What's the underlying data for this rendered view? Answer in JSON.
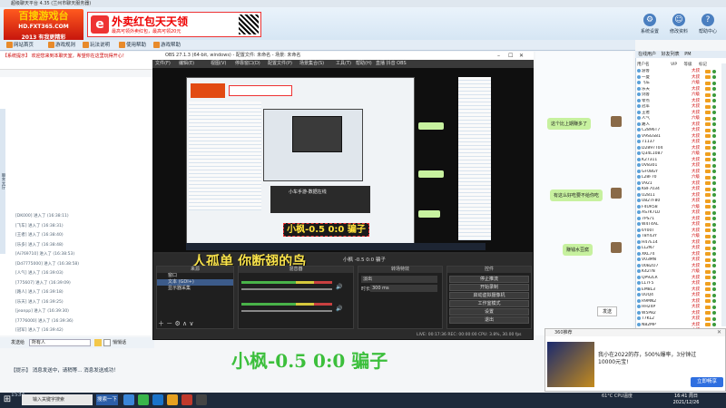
{
  "client": {
    "window_title": "超级聊天平台 4.35 (兰州市聊天服务器)",
    "logo_main": "百搜游戏台",
    "logo_url": "HD.FXT365.COM",
    "logo_sub": "2013 有我更精彩",
    "ad_text": "外卖红包天天领",
    "ad_sub": "最高可领外卖红包，最高可领20元",
    "header_buttons": [
      "系统设置",
      "修改资料",
      "帮助中心"
    ],
    "tabs": [
      "网站首页",
      "游戏规则",
      "玩法说明",
      "使用帮助",
      "游戏帮助"
    ],
    "announcement": "【系统提示】 欢迎您来到本聊天室，希望你在这里玩得开心！",
    "left_rail_label": "聊天大厅",
    "messages": [
      "[DK000] 进入了 (16:38:11)",
      "[飞车] 进入了 (16:38:31)",
      "[王者] 进入了 (16:38:40)",
      "[乐多] 进入了 (16:38:48)",
      "[Ai769710] 进入了 (16:38:53)",
      "[Dd7775000] 进入了 (16:38:58)",
      "[人气] 进入了 (16:39:03)",
      "[775607] 进入了 (16:39:09)",
      "[路人] 进入了 (16:39:18)",
      "[乐天] 进入了 (16:39:25)",
      "[jeanpp] 进入了 (16:39:30)",
      "[7776000] 进入了 (16:39:36)",
      "[冠军] 进入了 (16:39:42)"
    ],
    "input_label": "发送给",
    "input_value": "所有人",
    "checkbox_label": "悄悄话",
    "bottom_status": "【提示】 消息发送中，请稍等... 消息发送成功！",
    "send_label": "发送"
  },
  "userlist": {
    "tabs": [
      "在线用户",
      "好友列表",
      "PM"
    ],
    "headers": [
      "用户名",
      "VIP",
      "等级",
      "标记"
    ],
    "users": [
      {
        "name": "游客",
        "level": "大叔"
      },
      {
        "name": "一夏",
        "level": "大叔"
      },
      {
        "name": "飞车",
        "level": "六级"
      },
      {
        "name": "乐天",
        "level": "大叔"
      },
      {
        "name": "剑客",
        "level": "六级"
      },
      {
        "name": "零点",
        "level": "大叔"
      },
      {
        "name": "冠军",
        "level": "大叔"
      },
      {
        "name": "王者",
        "level": "大叔"
      },
      {
        "name": "人气",
        "level": "六级"
      },
      {
        "name": "路人",
        "level": "大叔"
      },
      {
        "name": "C2896T7",
        "level": "大叔"
      },
      {
        "name": "V9SGS81",
        "level": "大叔"
      },
      {
        "name": "71137",
        "level": "大叔"
      },
      {
        "name": "D2897T04",
        "level": "大叔"
      },
      {
        "name": "Q34L1087",
        "level": "六级"
      },
      {
        "name": "K27311",
        "level": "大叔"
      },
      {
        "name": "0V8301",
        "level": "大叔"
      },
      {
        "name": "GF08GY",
        "level": "大叔"
      },
      {
        "name": "L28F70",
        "level": "六级"
      },
      {
        "name": "V921",
        "level": "大叔"
      },
      {
        "name": "K8F7034",
        "level": "大叔"
      },
      {
        "name": "U2811",
        "level": "大叔"
      },
      {
        "name": "U827F80",
        "level": "大叔"
      },
      {
        "name": "F4UR58",
        "level": "六级"
      },
      {
        "name": "AS7K7LU",
        "level": "大叔"
      },
      {
        "name": "7PS71",
        "level": "大叔"
      },
      {
        "name": "W4T4AL",
        "level": "大叔"
      },
      {
        "name": "6Y00T",
        "level": "大叔"
      },
      {
        "name": "T8Y43Y",
        "level": "六级"
      },
      {
        "name": "H47E14",
        "level": "大叔"
      },
      {
        "name": "LL2N7",
        "level": "大叔"
      },
      {
        "name": "XKL74",
        "level": "大叔"
      },
      {
        "name": "V03MN",
        "level": "大叔"
      },
      {
        "name": "00BZO7",
        "level": "大叔"
      },
      {
        "name": "K42TN",
        "level": "六级"
      },
      {
        "name": "QP92LR",
        "level": "大叔"
      },
      {
        "name": "LL7F5",
        "level": "大叔"
      },
      {
        "name": "EM8L3",
        "level": "大叔"
      },
      {
        "name": "UUQ4",
        "level": "大叔"
      },
      {
        "name": "R9MN2",
        "level": "大叔"
      },
      {
        "name": "HH24P",
        "level": "大叔"
      },
      {
        "name": "W5P82",
        "level": "大叔"
      },
      {
        "name": "T7KL2",
        "level": "大叔"
      },
      {
        "name": "N82MP",
        "level": "大叔"
      },
      {
        "name": "MM2LK",
        "level": "大叔"
      }
    ]
  },
  "bubbles": [
    "这个比上期赚多了",
    "有这么好吃要不给你吃",
    "赚钱水豆腐"
  ],
  "obs": {
    "title": "OBS 27.1.3 (64-bit, windows) - 配置文件: 未命名 - 场景: 未命名",
    "menu": [
      "文件(F)",
      "编辑(E)",
      "视图(V)",
      "停靠窗口(D)",
      "配置文件(P)",
      "场景集合(S)",
      "工具(T)",
      "帮助(H)",
      "直播 抖音 OBS"
    ],
    "inner_caption": "小枫-0.5  0:0  骗子",
    "inner_overlay": "小车手游-数据在线",
    "person_caption": "人孤单 你断翅的鸟",
    "scene_name": "小枫 -0.5  0:0  骗子",
    "sources_title": "来源",
    "sources": [
      "窗口",
      "文本 (GDI+)",
      "显示器采集"
    ],
    "mixer_title": "混音器",
    "transition_title": "转场特效",
    "transition_value": "淡出",
    "duration_label": "时长",
    "duration_value": "300 ms",
    "controls_title": "控件",
    "controls": [
      "停止推流",
      "开始录制",
      "启动虚拟摄像机",
      "工作室模式",
      "设置",
      "退出"
    ],
    "status": "LIVE: 00:17:36   REC: 00:00:00   CPU: 3.8%, 30.00 fps"
  },
  "big_caption": "小枫-0.5  0:0  骗子",
  "popup": {
    "head": "360推荐",
    "title": "我小在2022的存，500%爆率，3分钟过10000元宝!",
    "button": "立即畅享"
  },
  "taskbar": {
    "search_placeholder": "输入关键字搜索",
    "search_button": "搜索一下",
    "tray": "61°C  CPU温度",
    "time": "16:41 周日",
    "date": "2021/12/26",
    "watermark": "1534"
  }
}
